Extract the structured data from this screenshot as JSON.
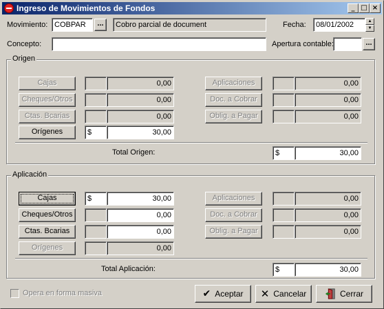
{
  "window": {
    "title": "Ingreso de Movimientos de Fondos"
  },
  "header": {
    "movimiento_label": "Movimiento:",
    "movimiento_code": "COBPAR",
    "movimiento_desc": "Cobro parcial de document",
    "fecha_label": "Fecha:",
    "fecha_value": "08/01/2002",
    "concepto_label": "Concepto:",
    "concepto_value": "",
    "apertura_label": "Apertura contable:",
    "apertura_value": "",
    "ellipsis": "..."
  },
  "origen": {
    "title": "Origen",
    "left": [
      {
        "label": "Cajas",
        "currency": "",
        "amount": "0,00",
        "enabled": false
      },
      {
        "label": "Cheques/Otros",
        "currency": "",
        "amount": "0,00",
        "enabled": false
      },
      {
        "label": "Ctas. Bcarias",
        "currency": "",
        "amount": "0,00",
        "enabled": false
      },
      {
        "label": "Orígenes",
        "currency": "$",
        "amount": "30,00",
        "enabled": true
      }
    ],
    "right": [
      {
        "label": "Aplicaciones",
        "currency": "",
        "amount": "0,00",
        "enabled": false
      },
      {
        "label": "Doc. a Cobrar",
        "currency": "",
        "amount": "0,00",
        "enabled": false
      },
      {
        "label": "Oblig. a Pagar",
        "currency": "",
        "amount": "0,00",
        "enabled": false
      }
    ],
    "total_label": "Total Origen:",
    "total_currency": "$",
    "total_amount": "30,00"
  },
  "aplicacion": {
    "title": "Aplicación",
    "left": [
      {
        "label": "Cajas",
        "currency": "$",
        "amount": "30,00",
        "enabled": true
      },
      {
        "label": "Cheques/Otros",
        "currency": "",
        "amount": "0,00",
        "enabled": true
      },
      {
        "label": "Ctas. Bcarias",
        "currency": "",
        "amount": "0,00",
        "enabled": true
      },
      {
        "label": "Orígenes",
        "currency": "",
        "amount": "0,00",
        "enabled": false
      }
    ],
    "right": [
      {
        "label": "Aplicaciones",
        "currency": "",
        "amount": "0,00",
        "enabled": false
      },
      {
        "label": "Doc. a Cobrar",
        "currency": "",
        "amount": "0,00",
        "enabled": false
      },
      {
        "label": "Oblig. a Pagar",
        "currency": "",
        "amount": "0,00",
        "enabled": false
      }
    ],
    "total_label": "Total Aplicación:",
    "total_currency": "$",
    "total_amount": "30,00"
  },
  "footer": {
    "masiva_label": "Opera en forma masiva",
    "aceptar": "Aceptar",
    "cancelar": "Cancelar",
    "cerrar": "Cerrar"
  },
  "icons": {
    "app": "app-logo-icon",
    "minimize": "minimize-icon",
    "maximize": "maximize-icon",
    "close": "close-icon",
    "aceptar": "check-icon",
    "cancelar": "x-icon",
    "cerrar": "exit-door-icon"
  },
  "colors": {
    "title_start": "#0a246a",
    "title_end": "#a6caf0",
    "face": "#d4d0c8"
  }
}
